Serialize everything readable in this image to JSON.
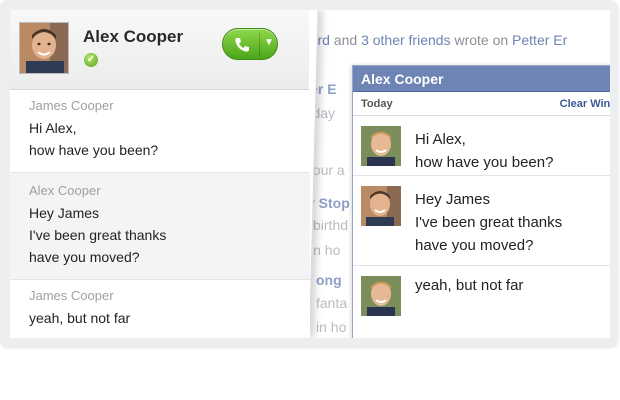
{
  "feed": {
    "title_prefix": "oford",
    "title_and": " and ",
    "title_link": "3 other friends",
    "title_suffix": " wrote on ",
    "title_target": "Petter Er",
    "lines": [
      {
        "text": "etter E",
        "style": "link"
      },
      {
        "text": "irthday",
        "style": "gray"
      },
      {
        "text": "hour a",
        "style": "gray"
      },
      {
        "text": "y Stop",
        "style": "link"
      },
      {
        "text": "birthd",
        "style": "gray"
      },
      {
        "text": "in ho",
        "style": "gray"
      },
      {
        "text": "ong",
        "style": "link"
      },
      {
        "text": "fanta",
        "style": "gray"
      },
      {
        "text": "in ho",
        "style": "gray"
      }
    ]
  },
  "skype": {
    "contact_name": "Alex Cooper",
    "status_icon": "online-check-icon",
    "call_button_icon": "phone-icon",
    "accent_green": "#4aa619",
    "messages": [
      {
        "sender": "James Cooper",
        "lines": [
          "Hi Alex,",
          "how have you been?"
        ]
      },
      {
        "sender": "Alex Cooper",
        "lines": [
          "Hey James",
          "I've been great thanks",
          "have you moved?"
        ]
      },
      {
        "sender": "James Cooper",
        "lines": [
          "yeah, but not far"
        ]
      }
    ]
  },
  "fbchat": {
    "title": "Alex Cooper",
    "today_label": "Today",
    "clear_label": "Clear Wind",
    "header_color": "#6d84b4",
    "messages": [
      {
        "lines": [
          "Hi Alex,",
          "how have you been?"
        ]
      },
      {
        "lines": [
          "Hey James",
          "I've been great thanks",
          "have you moved?"
        ]
      },
      {
        "lines": [
          "yeah, but not far"
        ]
      }
    ]
  }
}
